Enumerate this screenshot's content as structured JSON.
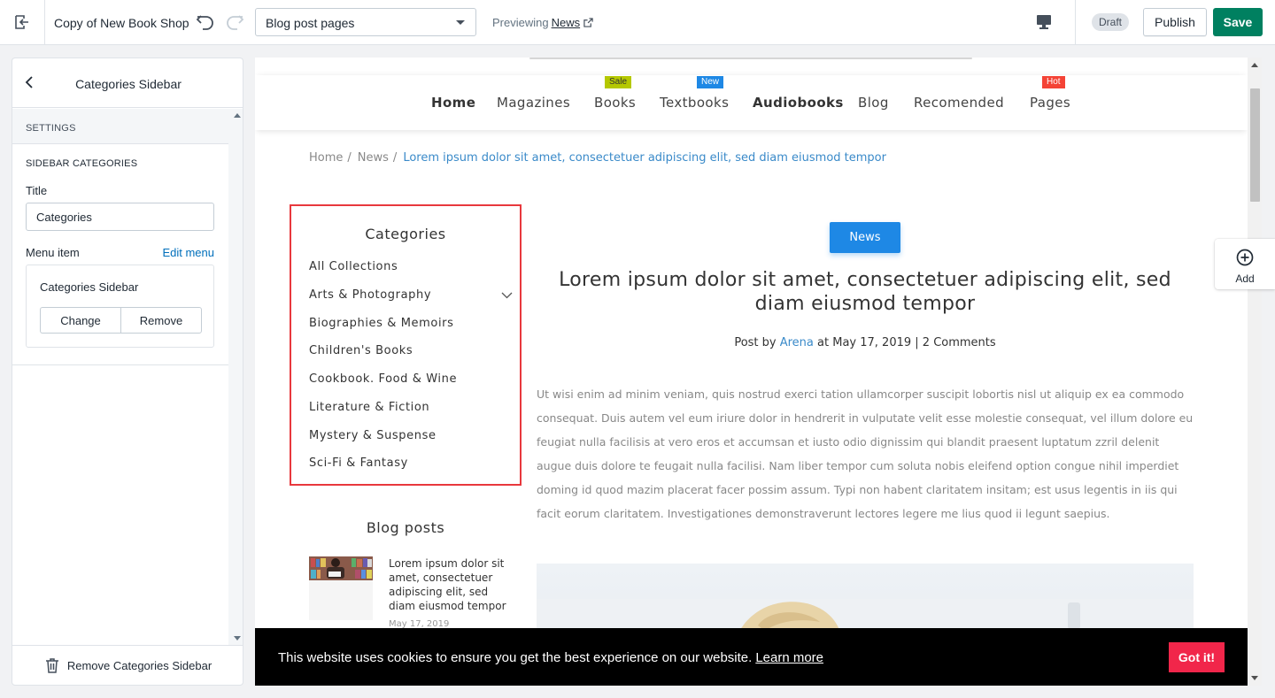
{
  "topbar": {
    "shop_name": "Copy of New Book Shop",
    "template_select": "Blog post pages",
    "previewing_label": "Previewing",
    "previewing_link": "News",
    "draft_badge": "Draft",
    "publish_label": "Publish",
    "save_label": "Save"
  },
  "panel": {
    "title": "Categories Sidebar",
    "settings_heading": "SETTINGS",
    "section_heading": "SIDEBAR CATEGORIES",
    "title_label": "Title",
    "title_value": "Categories",
    "menu_label": "Menu item",
    "edit_menu": "Edit menu",
    "menu_name": "Categories Sidebar",
    "change_label": "Change",
    "remove_label": "Remove",
    "remove_section": "Remove Categories Sidebar"
  },
  "preview": {
    "nav": [
      {
        "label": "Home",
        "badge": ""
      },
      {
        "label": "Magazines",
        "badge": ""
      },
      {
        "label": "Books",
        "badge": "Sale"
      },
      {
        "label": "Textbooks",
        "badge": "New"
      },
      {
        "label": "Audiobooks",
        "badge": ""
      },
      {
        "label": "Blog",
        "badge": ""
      },
      {
        "label": "Recomended",
        "badge": ""
      },
      {
        "label": "Pages",
        "badge": "Hot"
      }
    ],
    "breadcrumb": {
      "home": "Home",
      "sep": "/",
      "news": "News",
      "current": "Lorem ipsum dolor sit amet, consectetuer adipiscing elit, sed diam eiusmod tempor"
    },
    "categories": {
      "title": "Categories",
      "items": [
        "All Collections",
        "Arts & Photography",
        "Biographies & Memoirs",
        "Children's Books",
        "Cookbook. Food & Wine",
        "Literature & Fiction",
        "Mystery & Suspense",
        "Sci-Fi & Fantasy"
      ]
    },
    "blog_posts": {
      "title": "Blog posts",
      "item_title": "Lorem ipsum dolor sit amet, consectetuer adipiscing elit, sed diam eiusmod tempor",
      "item_date": "May 17, 2019"
    },
    "post": {
      "tag": "News",
      "title": "Lorem ipsum dolor sit amet, consectetuer adipiscing elit, sed diam eiusmod tempor",
      "post_by": "Post by",
      "author": "Arena",
      "date_text": "at May 17, 2019",
      "comments": "| 2 Comments",
      "body": "Ut wisi enim ad minim veniam, quis nostrud exerci tation ullamcorper suscipit lobortis nisl ut aliquip ex ea commodo consequat. Duis autem vel eum iriure dolor in hendrerit in vulputate velit esse molestie consequat, vel illum dolore eu feugiat nulla facilisis at vero eros et accumsan et iusto odio dignissim qui blandit praesent luptatum zzril delenit augue duis dolore te feugait nulla facilisi. Nam liber tempor cum soluta nobis eleifend option congue nihil imperdiet doming id quod mazim placerat facer possim assum. Typi non habent claritatem insitam; est usus legentis in iis qui facit eorum claritatem. Investigationes demonstraverunt lectores legere me lius quod ii legunt saepius."
    },
    "cookie": {
      "message": "This website uses cookies to ensure you get the best experience on our website.",
      "learn_more": "Learn more",
      "button": "Got it!"
    }
  },
  "add_button": {
    "label": "Add"
  },
  "colors": {
    "save_green": "#008060",
    "link_blue": "#006fbb",
    "highlight_red": "#e8383d",
    "news_blue": "#1e88e5",
    "sale_badge": "#b5c800",
    "new_badge": "#1e88e5",
    "hot_badge": "#f44336",
    "cookie_button": "#f1264a"
  },
  "icons": {
    "exit": "exit-icon",
    "undo": "undo-icon",
    "redo": "redo-icon",
    "external": "external-link-icon",
    "desktop": "desktop-icon",
    "back": "chevron-left-icon",
    "trash": "trash-icon",
    "add": "plus-circle-icon",
    "chevron": "chevron-down-icon"
  }
}
